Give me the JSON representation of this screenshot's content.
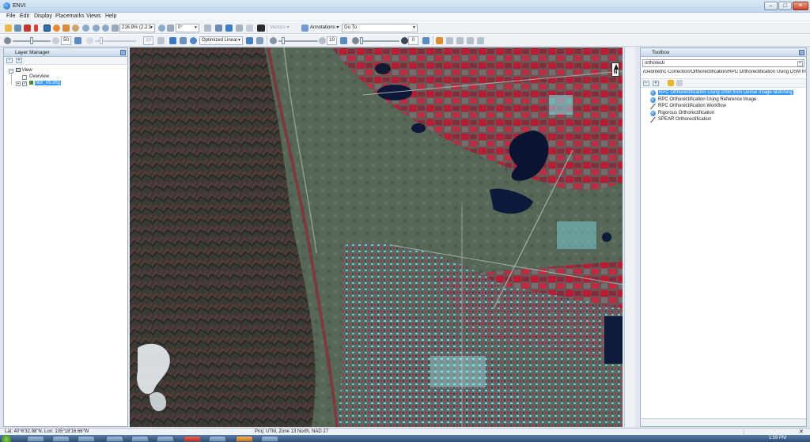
{
  "window": {
    "title": "ENVI"
  },
  "menubar": {
    "items": [
      "File",
      "Edit",
      "Display",
      "Placemarks",
      "Views",
      "Help"
    ]
  },
  "toolbar1": {
    "zoom_value": "216.9% (2.2:1",
    "rotation_value": "0°",
    "vector_label": "Vectors",
    "annotations_label": "Annotations",
    "goto_value": "Go To"
  },
  "toolbar2": {
    "brightness_value": "50",
    "transparency_value": "20",
    "stretch_value": "Optimized Linear",
    "sharpen_value": "10",
    "contrast_value": "0"
  },
  "layer_manager": {
    "title": "Layer Manager",
    "tree": {
      "view_label": "View",
      "overview_label": "Overview",
      "layer_label": "bldr_tm.img"
    }
  },
  "toolbox": {
    "title": "Toolbox",
    "search_value": "orthorecti",
    "path": "/Geometric Correction/Orthorectification/RPC Orthorectification Using DSM from",
    "items": [
      {
        "label": "RPC Orthorectification Using DSM from Dense Image Matching",
        "icon": "globe-icon",
        "selected": true
      },
      {
        "label": "RPC Orthorectification Using Reference Image",
        "icon": "globe-icon",
        "selected": false
      },
      {
        "label": "RPC Orthorectification Workflow",
        "icon": "wand-icon",
        "selected": false
      },
      {
        "label": "Rigorous Orthorectification",
        "icon": "globe-icon",
        "selected": false
      },
      {
        "label": "SPEAR Orthorectification",
        "icon": "wand-icon",
        "selected": false
      }
    ]
  },
  "statusbar": {
    "coords": "Lat: 40°6'32.98\"N, Lon: 105°18'16.66\"W",
    "projection": "Proj: UTM, Zone 13 North, NAD 27"
  },
  "taskbar": {
    "clock": "1:59 PM"
  },
  "colors": {
    "selection": "#3399ff",
    "vegetation_red": "#c8102e",
    "urban_cyan": "#7fe3e8",
    "water_dark": "#0a1430"
  }
}
